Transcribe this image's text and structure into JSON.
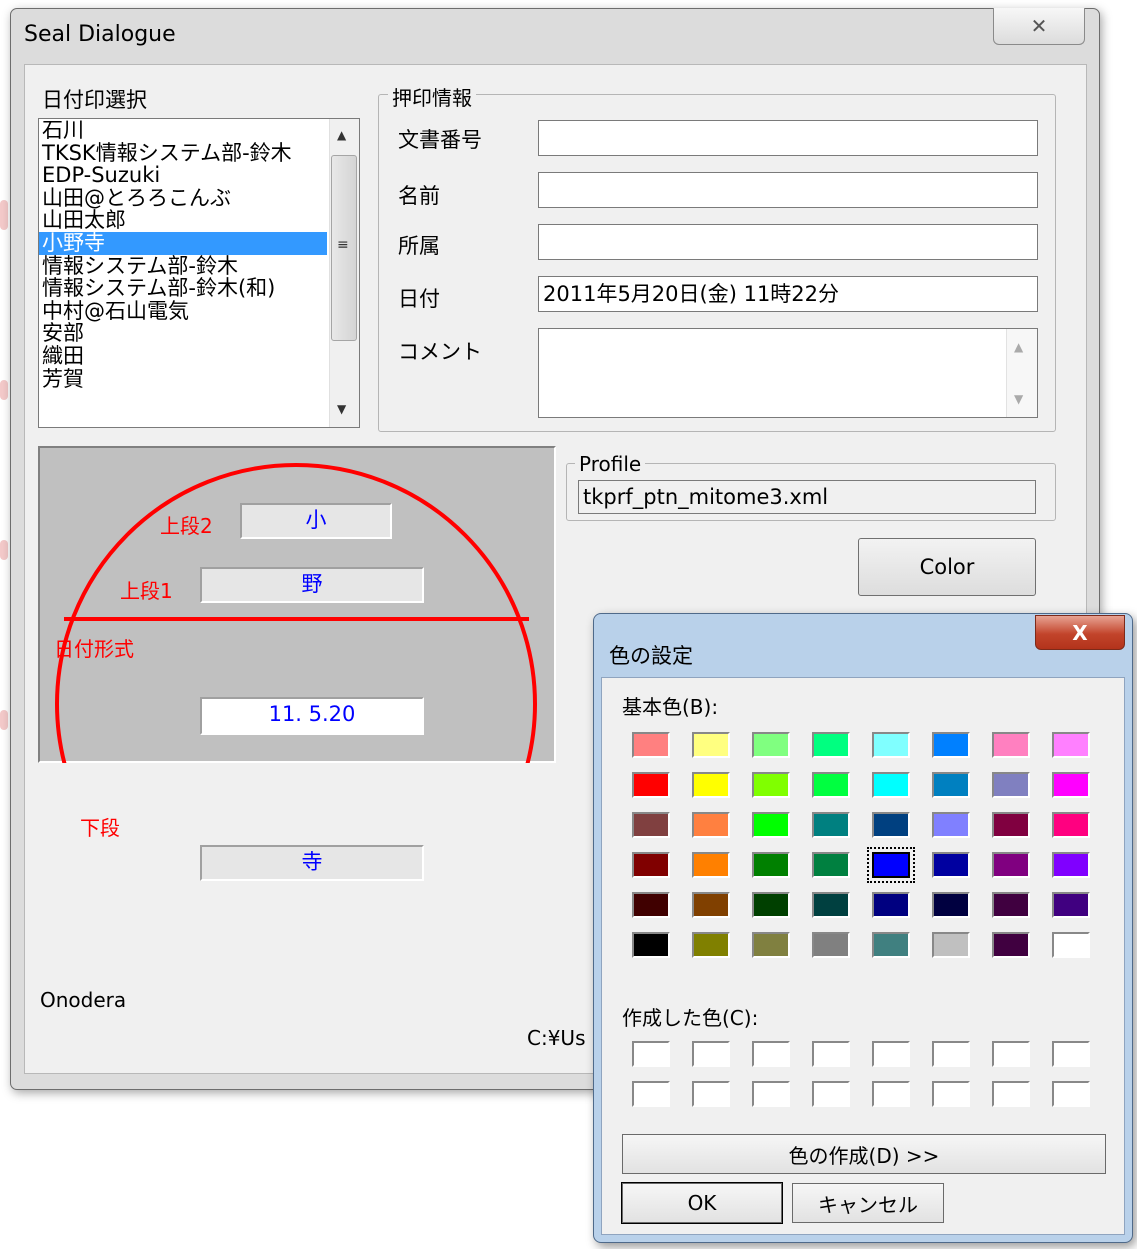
{
  "seal_dialog": {
    "title": "Seal Dialogue",
    "close_glyph": "✕",
    "date_stamp_select_label": "日付印選択",
    "seal_list": [
      "石川",
      "TKSK情報システム部-鈴木",
      "EDP-Suzuki",
      "山田@とろろこんぶ",
      "山田太郎",
      "小野寺",
      "情報システム部-鈴木",
      "情報システム部-鈴木(和)",
      "中村@石山電気",
      "安部",
      "織田",
      "芳賀"
    ],
    "selected_index": 5,
    "stamp_info": {
      "group_label": "押印情報",
      "doc_number_label": "文書番号",
      "doc_number_value": "",
      "name_label": "名前",
      "name_value": "",
      "dept_label": "所属",
      "dept_value": "",
      "date_label": "日付",
      "date_value": "2011年5月20日(金) 11時22分",
      "comment_label": "コメント",
      "comment_value": ""
    },
    "profile": {
      "label": "Profile",
      "value": "tkprf_ptn_mitome3.xml"
    },
    "color_button": "Color",
    "stamp": {
      "upper2_label": "上段2",
      "upper2_value": "小",
      "upper1_label": "上段1",
      "upper1_value": "野",
      "date_format_label": "日付形式",
      "date_value": "11. 5.20",
      "lower_label": "下段",
      "lower_value": "寺",
      "stamp_color": "#ff0000"
    },
    "footer_name": "Onodera",
    "footer_path": "C:¥Us"
  },
  "color_dialog": {
    "title": "色の設定",
    "close_glyph": "X",
    "basic_colors_label": "基本色(B):",
    "basic_colors": [
      "#ff8080",
      "#ffff80",
      "#80ff80",
      "#00ff80",
      "#80ffff",
      "#0080ff",
      "#ff80c0",
      "#ff80ff",
      "#ff0000",
      "#ffff00",
      "#80ff00",
      "#00ff40",
      "#00ffff",
      "#0080c0",
      "#8080c0",
      "#ff00ff",
      "#804040",
      "#ff8040",
      "#00ff00",
      "#008080",
      "#004080",
      "#8080ff",
      "#800040",
      "#ff0080",
      "#800000",
      "#ff8000",
      "#008000",
      "#008040",
      "#0000ff",
      "#0000a0",
      "#800080",
      "#8000ff",
      "#400000",
      "#804000",
      "#004000",
      "#004040",
      "#000080",
      "#000040",
      "#400040",
      "#400080",
      "#000000",
      "#808000",
      "#808040",
      "#808080",
      "#408080",
      "#c0c0c0",
      "#400040",
      "#ffffff"
    ],
    "selected_color_index": 28,
    "custom_colors_label": "作成した色(C):",
    "define_custom_button": "色の作成(D) >>",
    "ok_button": "OK",
    "cancel_button": "キャンセル"
  }
}
